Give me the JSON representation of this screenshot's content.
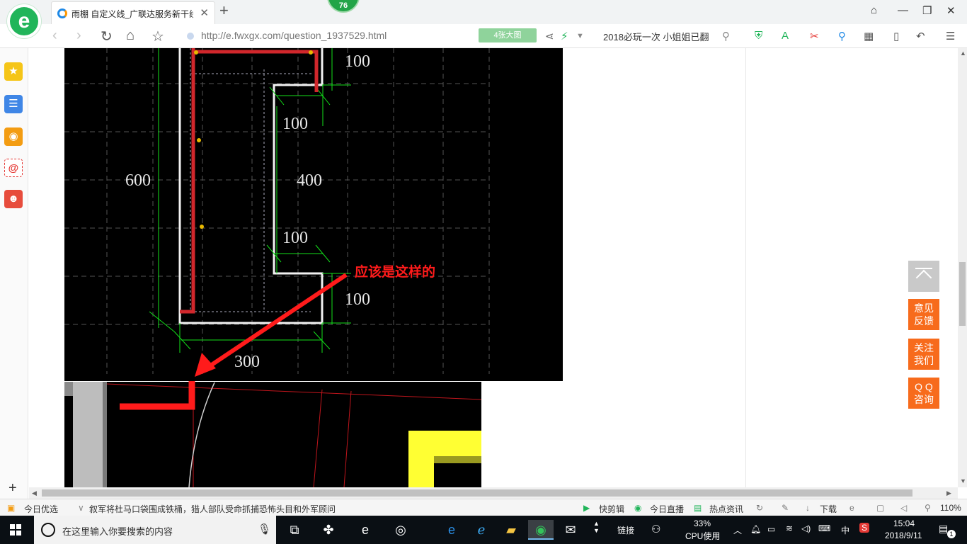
{
  "browser": {
    "logo_glyph": "e",
    "badge": "76",
    "tab_title": "雨棚 自定义线_广联达服务新干线",
    "tab_close": "✕",
    "new_tab": "+",
    "url": "http://e.fwxgx.com/question_1937529.html",
    "bigpic_label": "4张大图",
    "search_hint": "2018必玩一次 小姐姐已翻",
    "nav": {
      "back": "‹",
      "forward": "›",
      "reload": "↻",
      "home": "⌂",
      "star": "☆"
    }
  },
  "cad": {
    "dims": {
      "top_right": "100",
      "inner_top": "100",
      "left_height": "600",
      "inner_height": "400",
      "inner_bottom": "100",
      "bottom_right": "100",
      "bottom_width": "300"
    },
    "annotation": "应该是这样的",
    "colors": {
      "bg": "#000000",
      "grid": "#5a5a5a",
      "dim": "#13e01a",
      "outline": "#ffffff",
      "red": "#e3161d",
      "yellow": "#ffff33"
    }
  },
  "floating": {
    "feedback": "意见\n反馈",
    "follow": "关注\n我们",
    "qq": "Q Q\n咨询"
  },
  "statusbar": {
    "today_pick": "今日优选",
    "news": "叙军将杜马口袋围成铁桶，猎人部队受命抓捕恐怖头目和外军顾问",
    "quick_clip": "快剪辑",
    "live": "今日直播",
    "hot": "热点资讯",
    "download": "下载",
    "zoom": "110%"
  },
  "taskbar": {
    "search_placeholder": "在这里输入你要搜索的内容",
    "links": "链接",
    "cpu_percent": "33%",
    "cpu_label": "CPU使用",
    "ime": "中",
    "time": "15:04",
    "date": "2018/9/11",
    "notifications": "1"
  }
}
